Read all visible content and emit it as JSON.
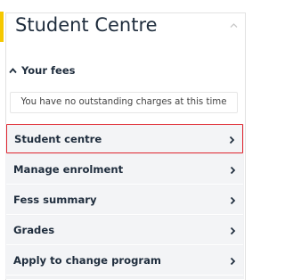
{
  "header": {
    "title": "Student Centre",
    "collapse_icon": "chevron-up-icon"
  },
  "fees": {
    "toggle_label": "Your fees",
    "toggle_icon": "caret-up-icon",
    "message": "You have no outstanding charges at this time"
  },
  "menu": {
    "items": [
      {
        "label": "Student centre",
        "selected": true
      },
      {
        "label": "Manage enrolment",
        "selected": false
      },
      {
        "label": "Fess summary",
        "selected": false
      },
      {
        "label": "Grades",
        "selected": false
      },
      {
        "label": "Apply to change program",
        "selected": false
      }
    ],
    "item_icon": "chevron-right-icon"
  },
  "colors": {
    "accent": "#f5c800",
    "selected_border": "#e0262f",
    "menu_background": "#f3f4f6",
    "title_text": "#1f2d3d"
  }
}
